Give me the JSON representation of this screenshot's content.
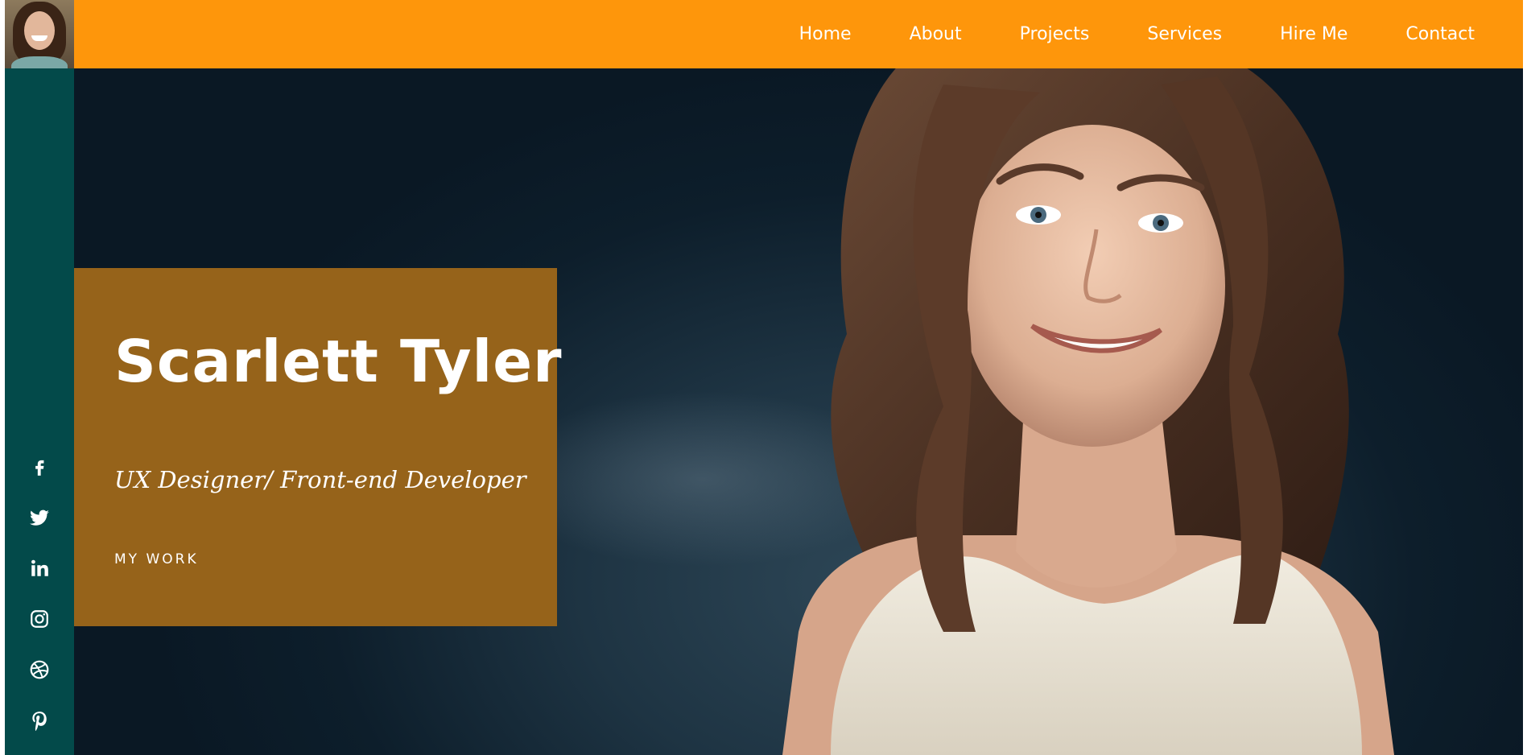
{
  "nav": {
    "items": [
      {
        "label": "Home"
      },
      {
        "label": "About"
      },
      {
        "label": "Projects"
      },
      {
        "label": "Services"
      },
      {
        "label": "Hire Me"
      },
      {
        "label": "Contact"
      }
    ]
  },
  "hero": {
    "name": "Scarlett Tyler",
    "role": "UX Designer/ Front-end Developer",
    "cta_label": "MY WORK"
  },
  "social": {
    "icons": [
      "facebook-icon",
      "twitter-icon",
      "linkedin-icon",
      "instagram-icon",
      "dribbble-icon",
      "pinterest-icon"
    ]
  },
  "colors": {
    "topbar": "#fe960b",
    "sidebar": "#034a4a",
    "card": "#96631a",
    "hero_background": "#0d1e2b",
    "text": "#ffffff"
  }
}
